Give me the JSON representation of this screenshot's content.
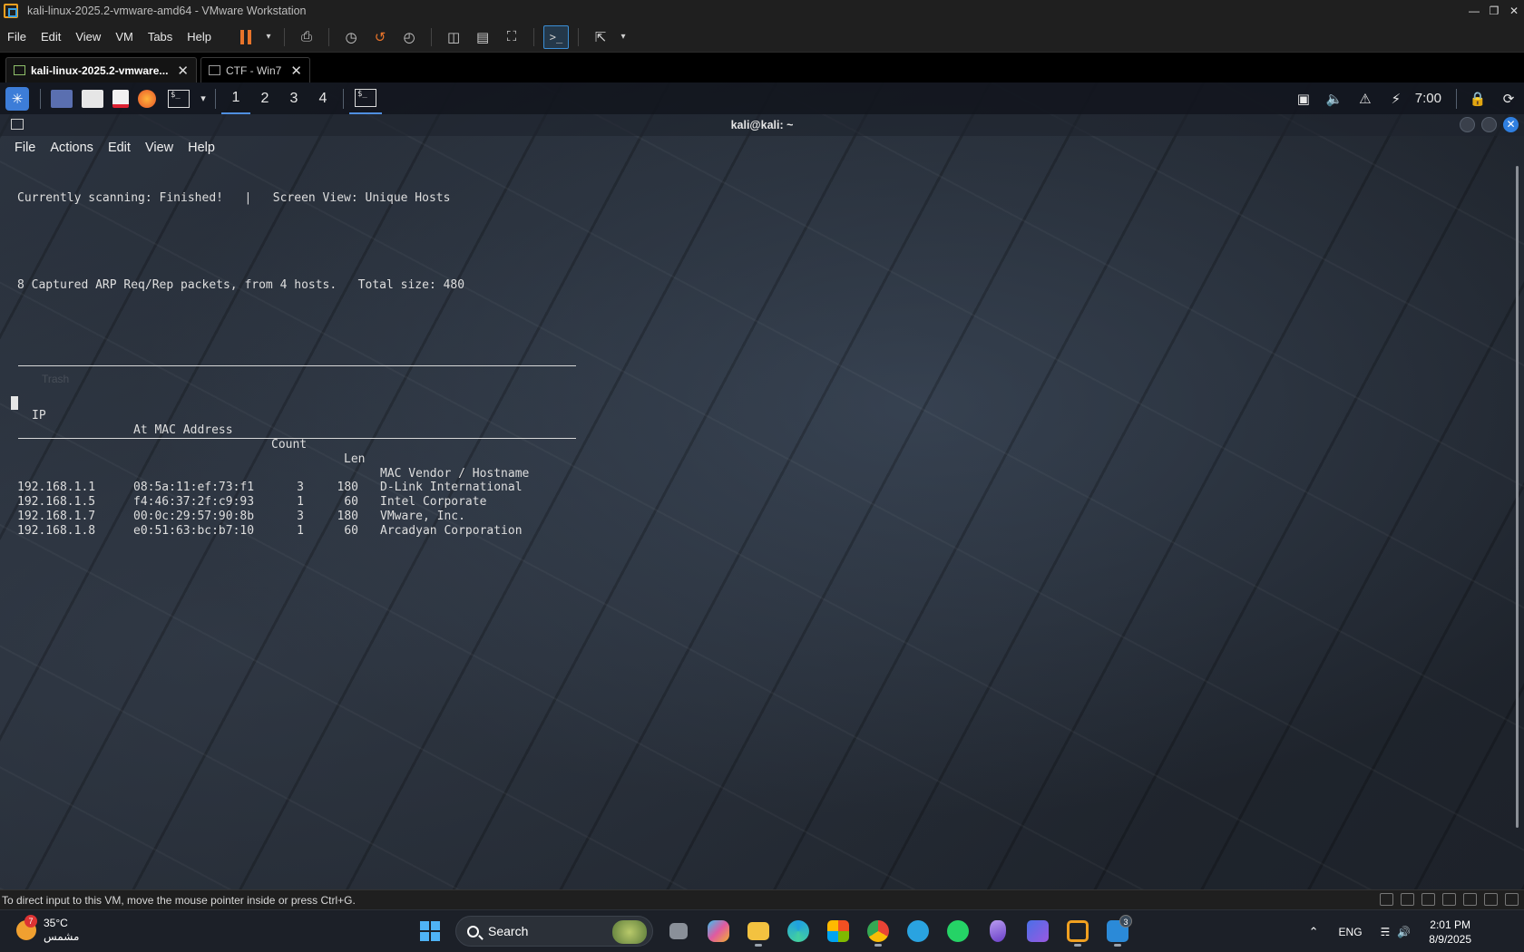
{
  "window": {
    "title": "kali-linux-2025.2-vmware-amd64 - VMware Workstation"
  },
  "vmware_menu": {
    "items": [
      "File",
      "Edit",
      "View",
      "VM",
      "Tabs",
      "Help"
    ]
  },
  "vmware_tabs": [
    {
      "label": "kali-linux-2025.2-vmware...",
      "active": true
    },
    {
      "label": "CTF - Win7",
      "active": false
    }
  ],
  "kali_panel": {
    "workspaces": [
      "1",
      "2",
      "3",
      "4"
    ],
    "current_workspace": "1",
    "clock": "7:00"
  },
  "terminal": {
    "title": "kali@kali: ~",
    "menu": [
      "File",
      "Actions",
      "Edit",
      "View",
      "Help"
    ],
    "status_line": "Currently scanning: Finished!   |   Screen View: Unique Hosts",
    "summary_line": "8 Captured ARP Req/Rep packets, from 4 hosts.   Total size: 480",
    "headers": [
      "IP",
      "At MAC Address",
      "Count",
      "Len",
      "MAC Vendor / Hostname"
    ],
    "rows": [
      [
        "192.168.1.1",
        "08:5a:11:ef:73:f1",
        "3",
        "180",
        "D-Link International"
      ],
      [
        "192.168.1.5",
        "f4:46:37:2f:c9:93",
        "1",
        "60",
        "Intel Corporate"
      ],
      [
        "192.168.1.7",
        "00:0c:29:57:90:8b",
        "3",
        "180",
        "VMware, Inc."
      ],
      [
        "192.168.1.8",
        "e0:51:63:bc:b7:10",
        "1",
        "60",
        "Arcadyan Corporation"
      ]
    ],
    "desktop_icon_label": "Trash"
  },
  "vmware_status": {
    "message": "To direct input to this VM, move the mouse pointer inside or press Ctrl+G."
  },
  "taskbar": {
    "weather_badge": "7",
    "temperature": "35°C",
    "condition": "مشمس",
    "search_placeholder": "Search",
    "language": "ENG",
    "time": "2:01 PM",
    "date": "8/9/2025",
    "vscode_badge": "3"
  },
  "colors": {
    "accent": "#3b8ed6",
    "pause": "#e8742a",
    "close_button": "#2f7fe0"
  }
}
